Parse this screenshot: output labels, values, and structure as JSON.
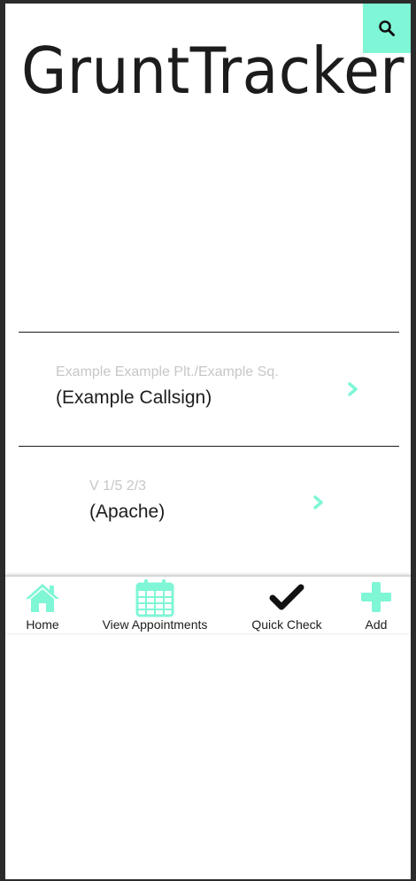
{
  "header": {
    "title": "GruntTracker",
    "search_icon": "search-icon",
    "accent_color": "#7ff6d6"
  },
  "entries": [
    {
      "subtitle": "Example Example Plt./Example Sq.",
      "name": "(Example Callsign)",
      "icon": "chevron-right-icon"
    },
    {
      "subtitle": "V 1/5 2/3",
      "name": "(Apache)",
      "icon": "chevron-right-icon"
    }
  ],
  "tabbar": {
    "items": [
      {
        "label": "Home",
        "icon": "home-icon"
      },
      {
        "label": "View Appointments",
        "icon": "calendar-icon"
      },
      {
        "label": "Quick Check",
        "icon": "checkmark-icon"
      },
      {
        "label": "Add",
        "icon": "plus-icon"
      }
    ]
  }
}
